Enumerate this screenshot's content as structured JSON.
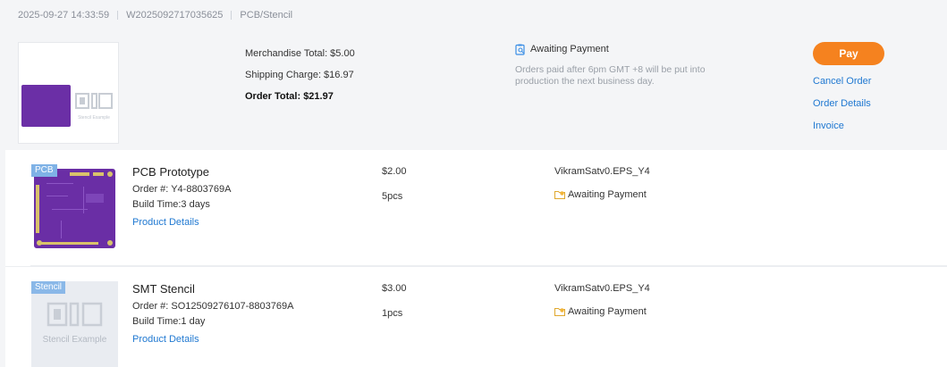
{
  "order": {
    "datetime": "2025-09-27 14:33:59",
    "order_id": "W2025092717035625",
    "category": "PCB/Stencil"
  },
  "summary": {
    "thumb_caption": "Stencil Example",
    "merchandise_total": "Merchandise Total: $5.00",
    "shipping_charge": "Shipping Charge: $16.97",
    "order_total": "Order Total: $21.97",
    "status": "Awaiting Payment",
    "status_note": "Orders paid after 6pm GMT +8 will be put into production the next business day.",
    "actions": {
      "pay": "Pay",
      "cancel": "Cancel Order",
      "details": "Order Details",
      "invoice": "Invoice"
    }
  },
  "items": [
    {
      "tag": "PCB",
      "name": "PCB Prototype",
      "order_no": "Order #: Y4-8803769A",
      "build_time": "Build Time:3 days",
      "link": "Product Details",
      "price": "$2.00",
      "qty": "5pcs",
      "file": "VikramSatv0.EPS_Y4",
      "status": "Awaiting Payment"
    },
    {
      "tag": "Stencil",
      "name": "SMT Stencil",
      "order_no": "Order #: SO12509276107-8803769A",
      "build_time": "Build Time:1 day",
      "link": "Product Details",
      "price": "$3.00",
      "qty": "1pcs",
      "file": "VikramSatv0.EPS_Y4",
      "status": "Awaiting Payment",
      "thumb_caption": "Stencil Example"
    }
  ],
  "colors": {
    "accent": "#f5821f",
    "link": "#1f78d1",
    "pcb": "#6a2ea5",
    "tag": "#7fb2e6"
  },
  "icons": {
    "status_summary": "clipboard-search-icon",
    "status_item": "folder-clock-icon"
  }
}
